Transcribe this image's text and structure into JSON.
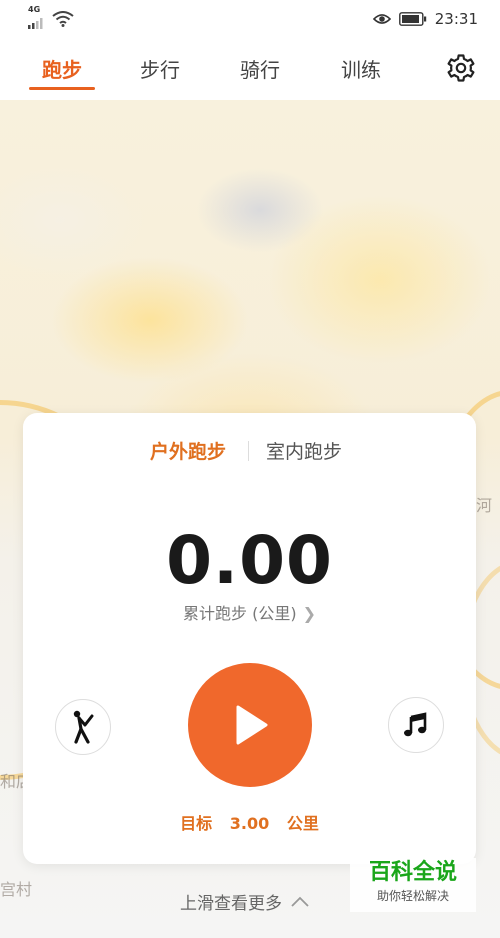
{
  "status_bar": {
    "network": "4G",
    "time": "23:31"
  },
  "tabs": [
    {
      "label": "跑步",
      "active": true
    },
    {
      "label": "步行",
      "active": false
    },
    {
      "label": "骑行",
      "active": false
    },
    {
      "label": "训练",
      "active": false
    }
  ],
  "map": {
    "labels": [
      "河",
      "和店",
      "宫村"
    ]
  },
  "card": {
    "modes": {
      "outdoor": "户外跑步",
      "indoor": "室内跑步"
    },
    "distance_value": "0.00",
    "distance_label": "累计跑步 (公里)",
    "goal": {
      "label": "目标",
      "value": "3.00",
      "unit": "公里"
    }
  },
  "more_hint": "上滑查看更多",
  "watermark": {
    "main": "百科全说",
    "sub": "助你轻松解决"
  },
  "colors": {
    "accent": "#e8611f",
    "start_button": "#f0682c"
  }
}
